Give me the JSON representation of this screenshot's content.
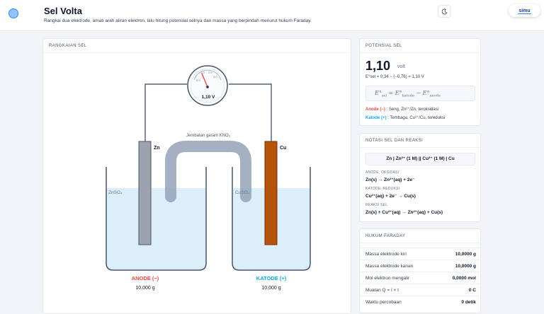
{
  "app": {
    "title": "Sel Volta",
    "subtitle": "Rangkai dua elektrode, amati arah aliran elektron, lalu hitung potensial selnya dan massa yang berpindah menurut hukum Faraday.",
    "brand": "simu"
  },
  "icons": {
    "logo": "circle-logo-icon",
    "theme": "moon-icon"
  },
  "colors": {
    "anode": "#ef4444",
    "cathode": "#0ea5e9",
    "zinc": "#9ca3af",
    "copper": "#b45309",
    "solution": "#dbeefa"
  },
  "cell": {
    "panel_title": "RANGKAIAN SEL",
    "voltmeter_reading": "1,10 V",
    "voltmeter_scale": [
      "0.0",
      "1.0",
      "2.0",
      "3.0"
    ],
    "salt_bridge_label": "Jembatan garam KNO₃",
    "left_electrode": "Zn",
    "right_electrode": "Cu",
    "left_solution": "ZnSO₄",
    "right_solution": "CuSO₄",
    "anode_label": "ANODE (−)",
    "cathode_label": "KATODE (+)",
    "anode_mass": "10,000 g",
    "cathode_mass": "10,000 g"
  },
  "potential": {
    "panel_title": "POTENSIAL SEL",
    "value": "1,10",
    "unit": "volt",
    "equation": "E°sel = 0,34 − (−0,76) = 1,10 V",
    "anode_role": "Anode (−)",
    "anode_desc": ": Seng, Zn²⁺/Zn, teroksidasi",
    "cathode_role": "Katode (+)",
    "cathode_desc": ": Tembaga, Cu²⁺/Cu, tereduksi"
  },
  "notation": {
    "panel_title": "NOTASI SEL DAN REAKSI",
    "cell_notation": "Zn | Zn²⁺ (1 M) || Cu²⁺ (1 M) | Cu",
    "anode_label": "ANODE, OKSIDASI",
    "anode_eq": "Zn(s) → Zn²⁺(aq) + 2e⁻",
    "cathode_label": "KATODE, REDUKSI",
    "cathode_eq": "Cu²⁺(aq) + 2e⁻ → Cu(s)",
    "cell_label": "REAKSI SEL",
    "cell_eq": "Zn(s) + Cu²⁺(aq) → Zn²⁺(aq) + Cu(s)"
  },
  "faraday": {
    "panel_title": "HUKUM FARADAY",
    "rows": [
      {
        "label": "Massa elektrode kiri",
        "value": "10,0000 g"
      },
      {
        "label": "Massa elektrode kanan",
        "value": "10,0000 g"
      },
      {
        "label": "Mol elektron mengalir",
        "value": "0,0000 mol"
      },
      {
        "label": "Muatan Q = I × t",
        "value": "0 C"
      },
      {
        "label": "Waktu percobaan",
        "value": "0 detik"
      }
    ]
  }
}
